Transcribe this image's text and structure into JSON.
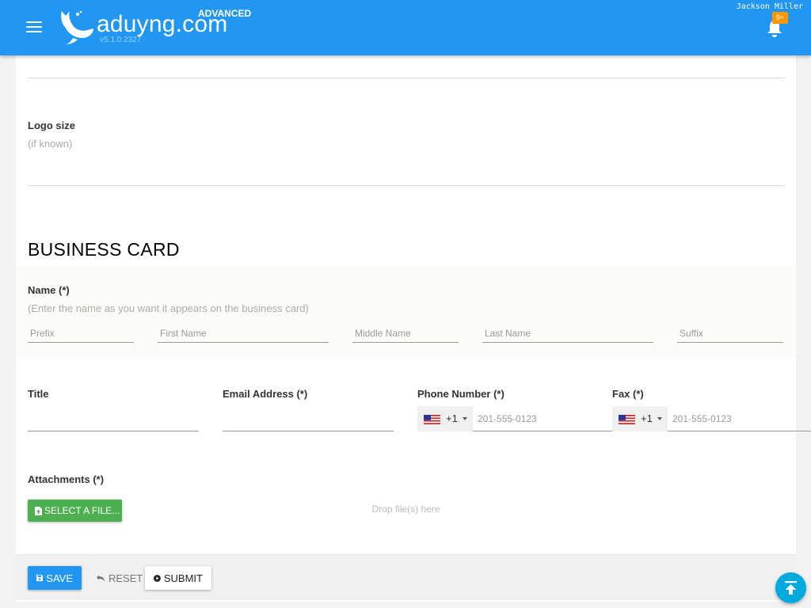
{
  "header": {
    "logo_text": "aduyng.com",
    "edition": "ADVANCED",
    "version": "v5.1.0.2327",
    "username": "Jackson Miller",
    "notification_count": "9+"
  },
  "form": {
    "logo_size": {
      "label": "Logo size",
      "hint": "(if known)"
    },
    "business_card": {
      "title": "BUSINESS CARD",
      "name": {
        "label": "Name (*)",
        "hint": "(Enter the name as you want it appears on the business card)",
        "placeholders": {
          "prefix": "Prefix",
          "first": "First Name",
          "middle": "Middle Name",
          "last": "Last Name",
          "suffix": "Suffix"
        }
      },
      "title_field": {
        "label": "Title"
      },
      "email": {
        "label": "Email Address (*)"
      },
      "phone": {
        "label": "Phone Number (*)",
        "dial_code": "+1",
        "placeholder": "201-555-0123"
      },
      "fax": {
        "label": "Fax (*)",
        "dial_code": "+1",
        "placeholder": "201-555-0123"
      },
      "attachments": {
        "label": "Attachments (*)",
        "select_button": "SELECT A FILE...",
        "drop_hint": "Drop file(s) here"
      }
    }
  },
  "actions": {
    "save": "SAVE",
    "reset": "RESET",
    "submit": "SUBMIT"
  },
  "colors": {
    "header": "#2196f3",
    "save": "#2196f3",
    "select_file": "#4caf50",
    "badge": "#ff9800",
    "scroll_top": "#00aadd"
  },
  "icons": [
    "menu-icon",
    "whale-logo-icon",
    "bell-icon",
    "us-flag-icon",
    "file-upload-icon",
    "floppy-icon",
    "undo-icon",
    "play-circle-icon",
    "arrow-up-to-top-icon"
  ]
}
